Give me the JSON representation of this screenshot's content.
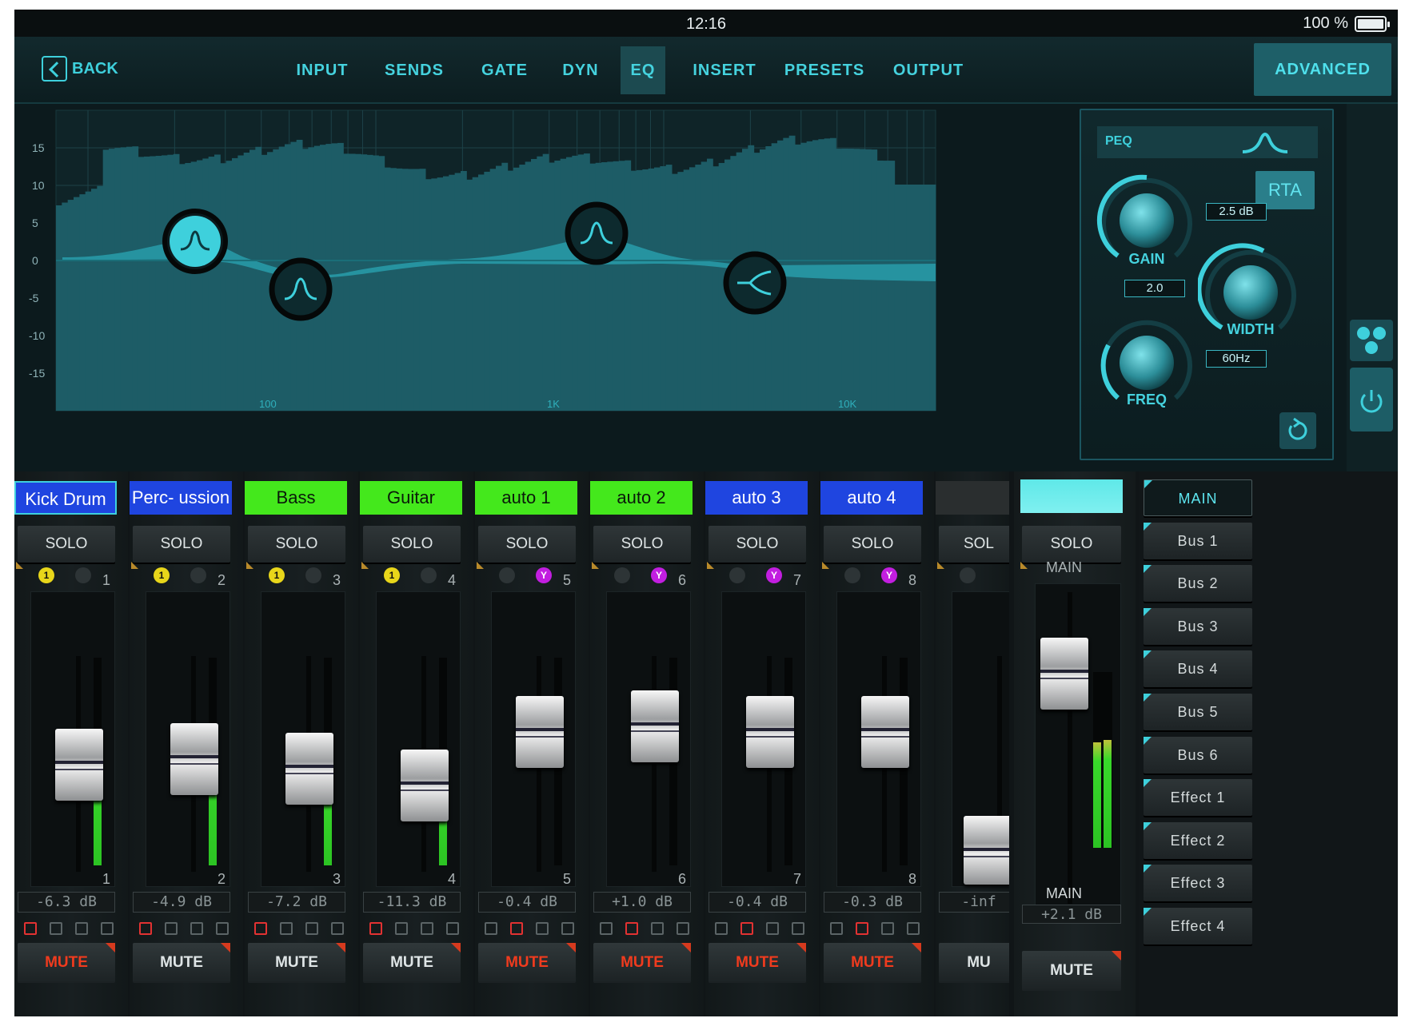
{
  "status": {
    "time": "12:16",
    "battery": "100 %"
  },
  "nav": {
    "back": "BACK",
    "tabs": [
      {
        "label": "INPUT"
      },
      {
        "label": "SENDS"
      },
      {
        "label": "GATE"
      },
      {
        "label": "DYN"
      },
      {
        "label": "EQ"
      },
      {
        "label": "INSERT"
      },
      {
        "label": "PRESETS"
      },
      {
        "label": "OUTPUT"
      }
    ],
    "active_tab": "EQ",
    "advanced": "ADVANCED"
  },
  "eq": {
    "y_ticks": [
      "15",
      "10",
      "5",
      "0",
      "-5",
      "-10",
      "-15"
    ],
    "x_ticks": [
      "100",
      "1K",
      "10K"
    ],
    "bands": [
      {
        "shape": "peak"
      },
      {
        "shape": "peak"
      },
      {
        "shape": "peak"
      },
      {
        "shape": "shelf"
      }
    ]
  },
  "peq": {
    "label": "PEQ",
    "rta": "RTA",
    "gain_label": "GAIN",
    "gain_value": "2.5 dB",
    "width_label": "WIDTH",
    "width_value": "2.0",
    "freq_label": "FREQ",
    "freq_value": "60Hz",
    "icons": {
      "shape": "peak-filter-icon",
      "reset": "reset-icon",
      "side": "channel-link-icon",
      "power": "power-icon"
    }
  },
  "channels": [
    {
      "name": "Kick Drum",
      "color": "#1f45e0",
      "text_color": "#ffffff",
      "number": "1",
      "db": "-6.3 dB",
      "group": "1",
      "group_color": "#e8d61a",
      "level": 0.58,
      "meter": 0.57,
      "mute_active": true,
      "route_red": 0,
      "selected": true
    },
    {
      "name": "Perc- ussion",
      "color": "#1f45e0",
      "text_color": "#ffffff",
      "number": "2",
      "db": "-4.9 dB",
      "group": "1",
      "group_color": "#e8d61a",
      "level": 0.61,
      "meter": 0.62,
      "mute_active": false,
      "route_red": 0
    },
    {
      "name": "Bass",
      "color": "#44e81c",
      "text_color": "#0a1a0a",
      "number": "3",
      "db": "-7.2 dB",
      "group": "1",
      "group_color": "#e8d61a",
      "level": 0.56,
      "meter": 0.4,
      "mute_active": false,
      "route_red": 0
    },
    {
      "name": "Guitar",
      "color": "#44e81c",
      "text_color": "#0a1a0a",
      "number": "4",
      "db": "-11.3 dB",
      "group": "1",
      "group_color": "#e8d61a",
      "level": 0.47,
      "meter": 0.46,
      "mute_active": false,
      "route_red": 0
    },
    {
      "name": "auto 1",
      "color": "#44e81c",
      "text_color": "#0a1a0a",
      "number": "5",
      "db": "-0.4 dB",
      "group": "Y",
      "group_color": "#c21ee0",
      "level": 0.75,
      "meter": 0.0,
      "mute_active": true,
      "route_red": 1
    },
    {
      "name": "auto 2",
      "color": "#44e81c",
      "text_color": "#0a1a0a",
      "number": "6",
      "db": "+1.0 dB",
      "group": "Y",
      "group_color": "#c21ee0",
      "level": 0.78,
      "meter": 0.0,
      "mute_active": true,
      "route_red": 1
    },
    {
      "name": "auto 3",
      "color": "#1f45e0",
      "text_color": "#ffffff",
      "number": "7",
      "db": "-0.4 dB",
      "group": "Y",
      "group_color": "#c21ee0",
      "level": 0.75,
      "meter": 0.0,
      "mute_active": true,
      "route_red": 1
    },
    {
      "name": "auto 4",
      "color": "#1f45e0",
      "text_color": "#ffffff",
      "number": "8",
      "db": "-0.3 dB",
      "group": "Y",
      "group_color": "#c21ee0",
      "level": 0.75,
      "meter": 0.0,
      "mute_active": true,
      "route_red": 1
    }
  ],
  "partial_channel": {
    "solo": "SOL",
    "db": "-inf",
    "mute": "MU"
  },
  "labels": {
    "solo": "SOLO",
    "mute": "MUTE"
  },
  "main": {
    "label": "MAIN",
    "solo": "SOLO",
    "db": "+2.1 dB",
    "mute": "MUTE",
    "level": 0.82,
    "meter": 0.6
  },
  "buses": [
    "MAIN",
    "Bus 1",
    "Bus 2",
    "Bus 3",
    "Bus 4",
    "Bus 5",
    "Bus 6",
    "Effect 1",
    "Effect 2",
    "Effect 3",
    "Effect 4"
  ],
  "active_bus": "MAIN"
}
